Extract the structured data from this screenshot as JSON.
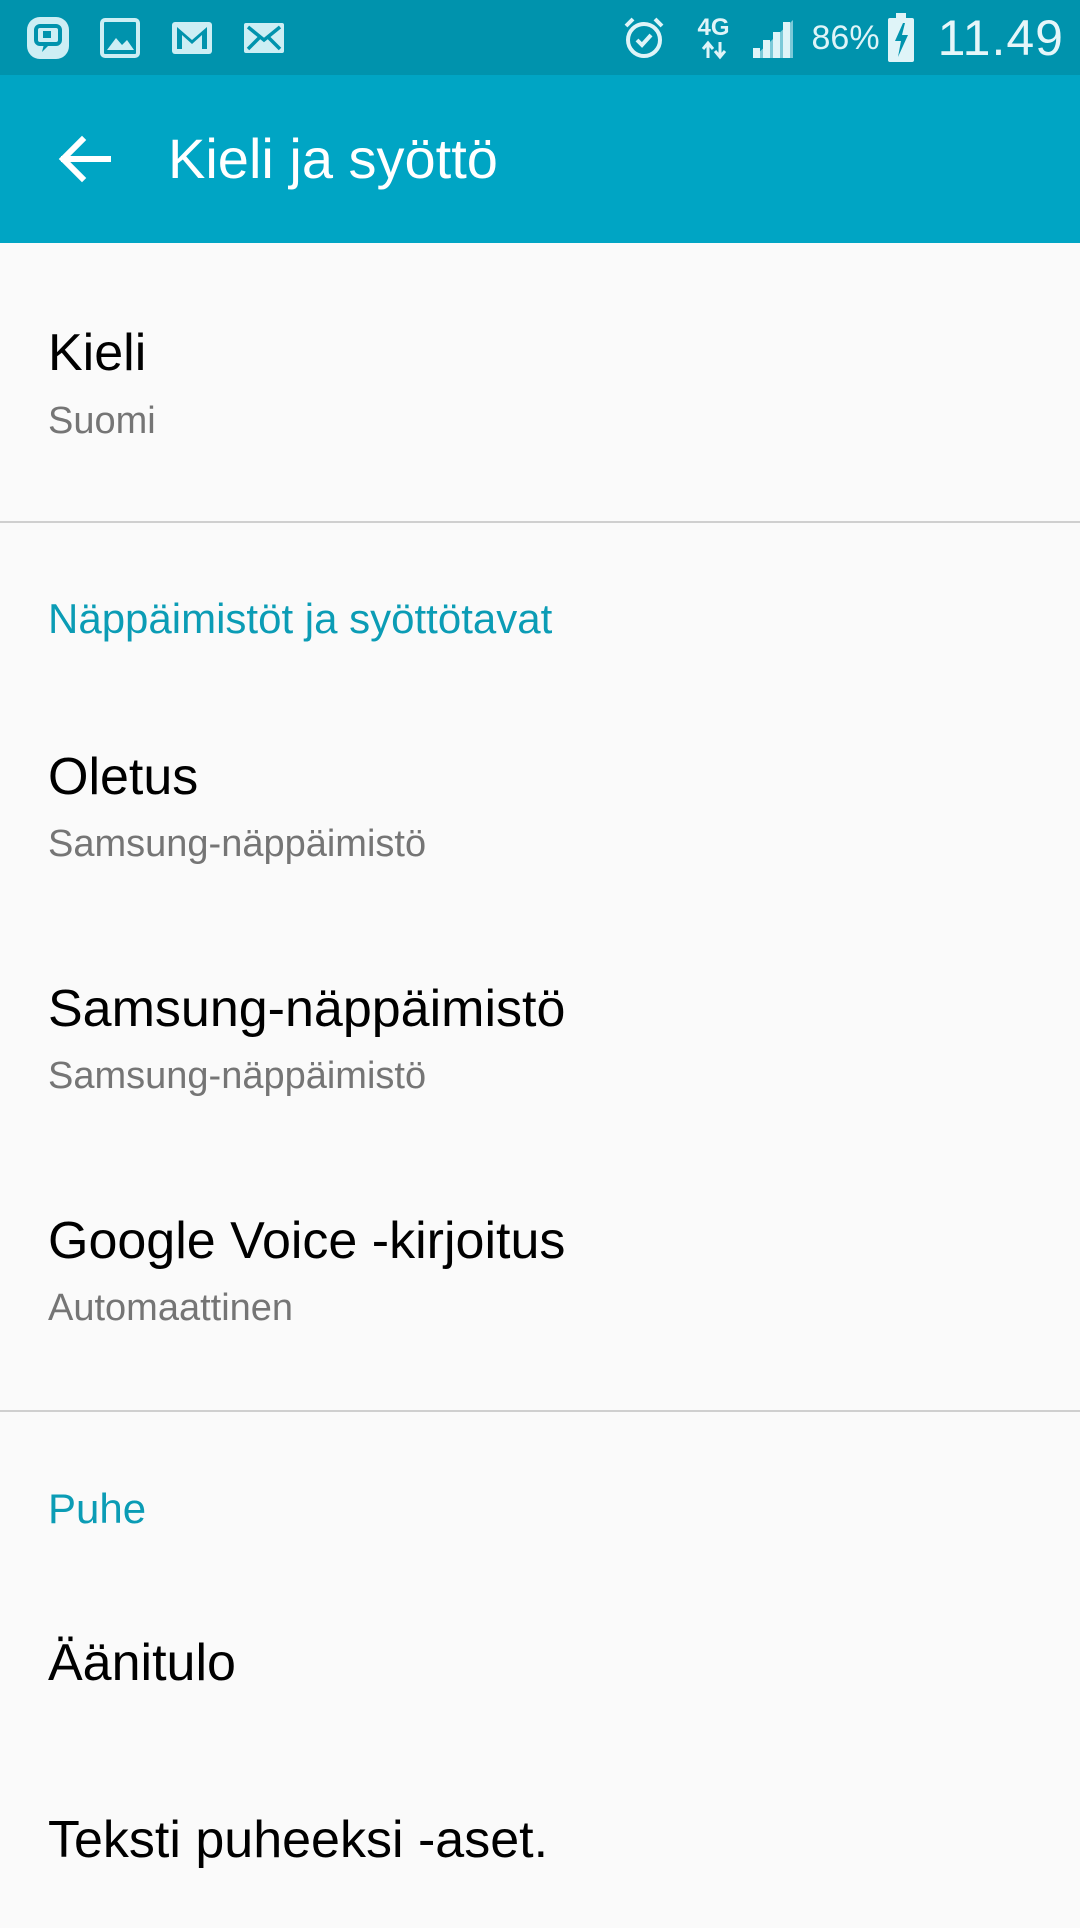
{
  "colors": {
    "status_bar": "#0093ad",
    "app_bar": "#00a5c4",
    "accent": "#0b9cb5",
    "background": "#fafafa"
  },
  "status_bar": {
    "notification_icons": [
      "messenger-icon",
      "gallery-icon",
      "gmail-icon",
      "email-icon"
    ],
    "alarm_icon": "alarm-icon",
    "network_label": "4G",
    "battery_percent": "86%",
    "time": "11.49"
  },
  "app_bar": {
    "back_icon": "arrow-left-icon",
    "title": "Kieli ja syöttö"
  },
  "language": {
    "title": "Kieli",
    "value": "Suomi"
  },
  "keyboards_section": {
    "header": "Näppäimistöt ja syöttötavat",
    "items": [
      {
        "title": "Oletus",
        "subtitle": "Samsung-näppäimistö"
      },
      {
        "title": "Samsung-näppäimistö",
        "subtitle": "Samsung-näppäimistö"
      },
      {
        "title": "Google Voice -kirjoitus",
        "subtitle": "Automaattinen"
      }
    ]
  },
  "speech_section": {
    "header": "Puhe",
    "items": [
      {
        "title": "Äänitulo"
      },
      {
        "title": "Teksti puheeksi -aset."
      }
    ]
  }
}
